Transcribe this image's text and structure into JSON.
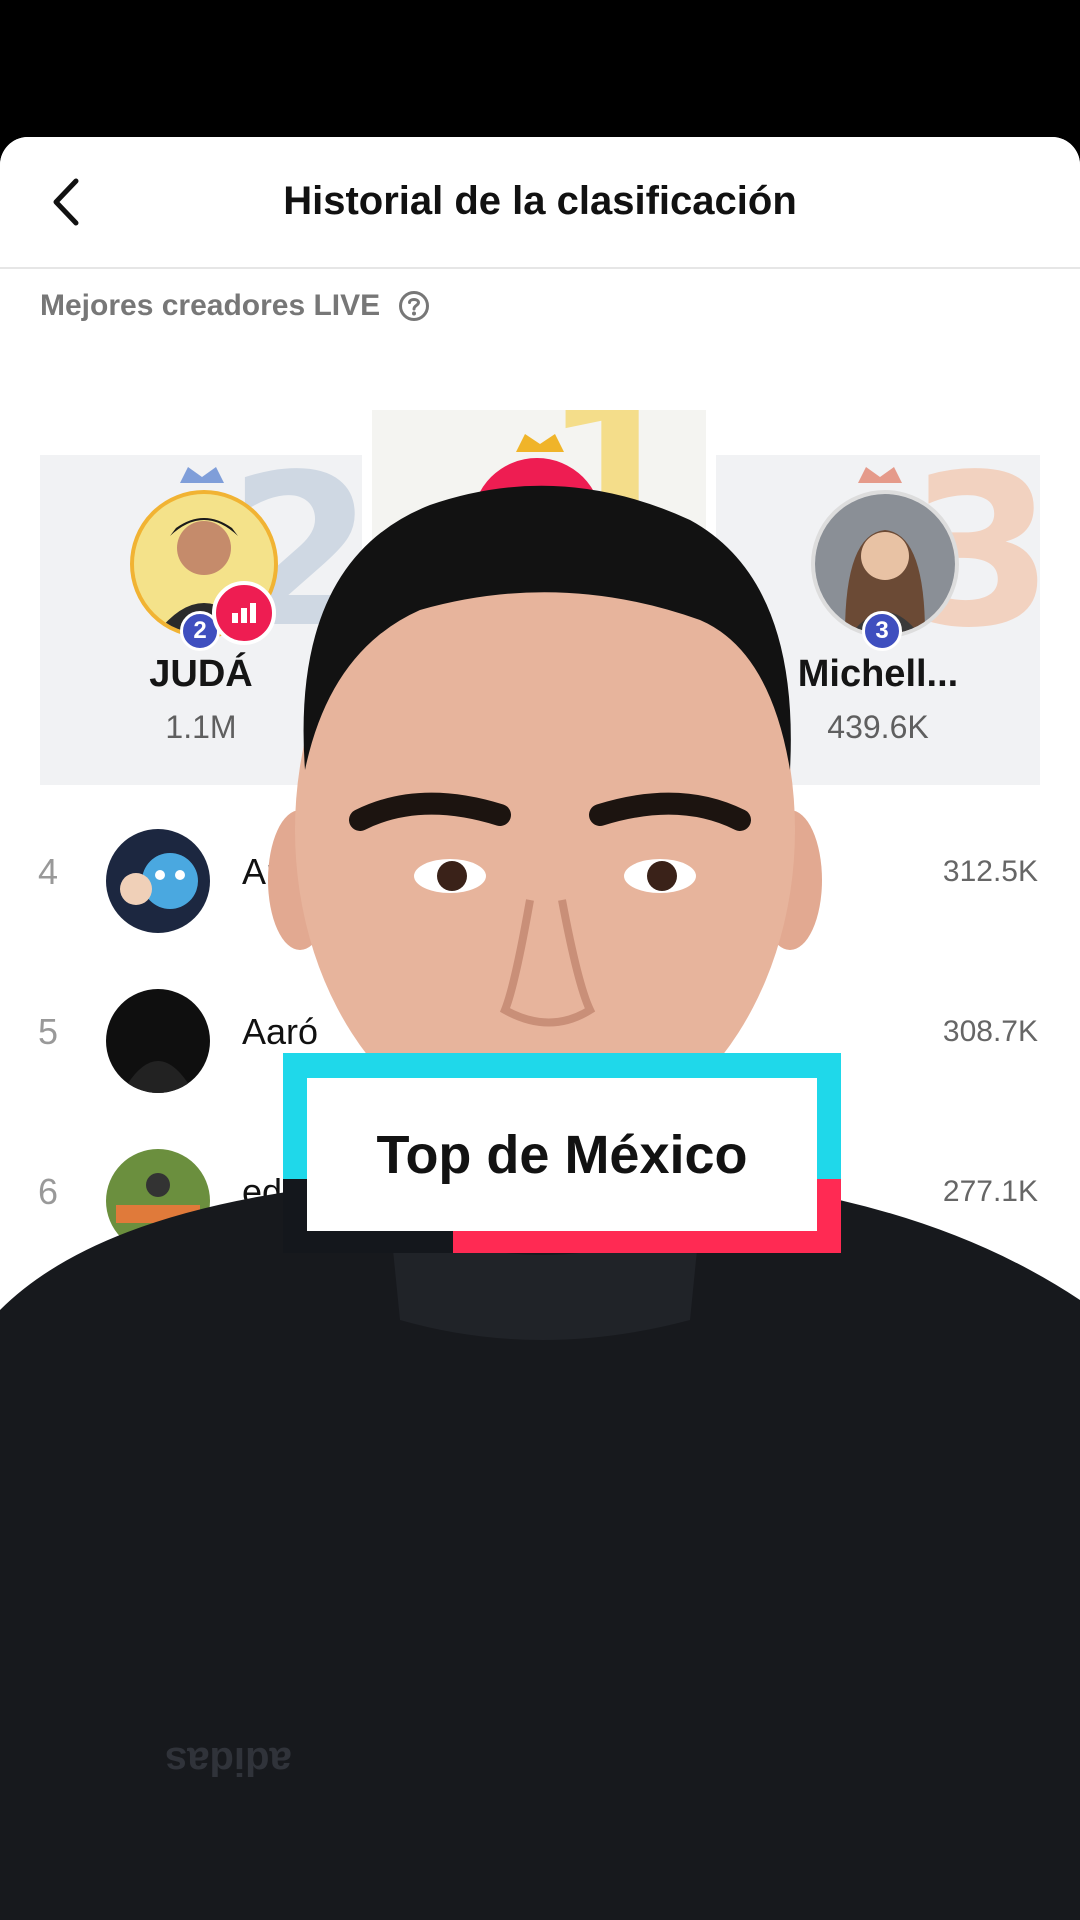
{
  "header": {
    "title": "Historial de la clasificación",
    "back_icon": "chevron-left-icon"
  },
  "section": {
    "label": "Mejores creadores LIVE",
    "help_icon": "question-circle-icon"
  },
  "podium": {
    "second": {
      "rank": "2",
      "big_rank": "2",
      "name": "JUDÁ",
      "score": "1.1M"
    },
    "first": {
      "rank": "1",
      "big_rank": "1"
    },
    "third": {
      "rank": "3",
      "big_rank": "3",
      "name": "Michell...",
      "score": "439.6K"
    }
  },
  "list": [
    {
      "rank": "4",
      "name": "An",
      "score": "312.5K"
    },
    {
      "rank": "5",
      "name": "Aaró",
      "score": "308.7K"
    },
    {
      "rank": "6",
      "name": "ed",
      "score": "277.1K"
    }
  ],
  "caption": "Top de México",
  "shirt_logo": "adidas",
  "colors": {
    "accent_cyan": "#1fd8ea",
    "accent_red": "#ff2a53",
    "live_badge": "#ee1d52"
  }
}
